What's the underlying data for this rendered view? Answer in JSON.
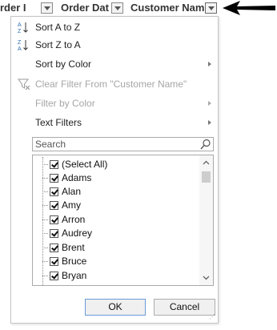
{
  "header": {
    "columns": [
      {
        "label": "rder I"
      },
      {
        "label": "Order Dat"
      },
      {
        "label": "Customer Nam"
      }
    ]
  },
  "menu": {
    "sort_a_to_z": "Sort A to Z",
    "sort_z_to_a": "Sort Z to A",
    "sort_by_color": "Sort by Color",
    "clear_filter": "Clear Filter From \"Customer Name\"",
    "filter_by_color": "Filter by Color",
    "text_filters": "Text Filters"
  },
  "search": {
    "placeholder": "Search"
  },
  "list": {
    "items": [
      {
        "label": "(Select All)",
        "checked": true
      },
      {
        "label": "Adams",
        "checked": true
      },
      {
        "label": "Alan",
        "checked": true
      },
      {
        "label": "Amy",
        "checked": true
      },
      {
        "label": "Arron",
        "checked": true
      },
      {
        "label": "Audrey",
        "checked": true
      },
      {
        "label": "Brent",
        "checked": true
      },
      {
        "label": "Bruce",
        "checked": true
      },
      {
        "label": "Bryan",
        "checked": true
      }
    ]
  },
  "buttons": {
    "ok": "OK",
    "cancel": "Cancel"
  }
}
